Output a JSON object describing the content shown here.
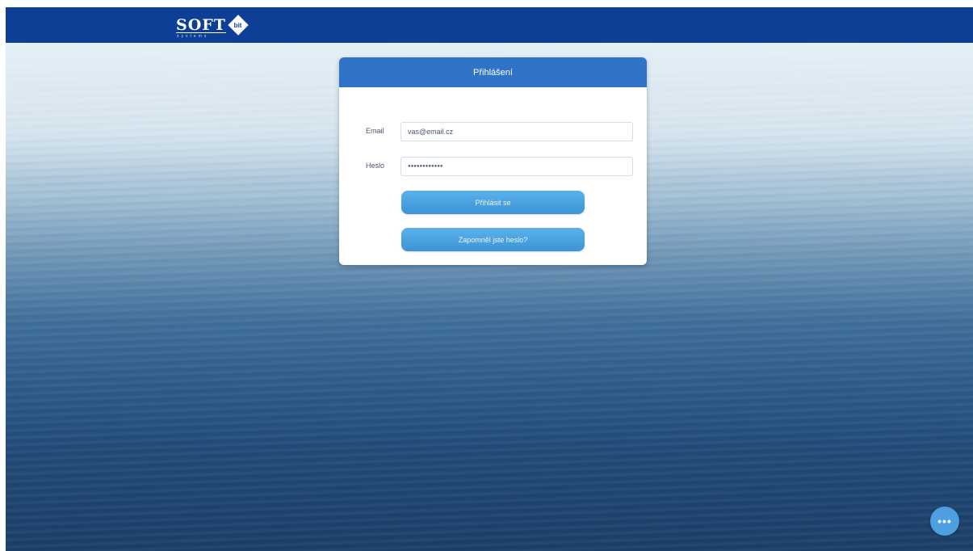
{
  "header": {
    "logo_text": "SOFT",
    "logo_badge": "bit",
    "logo_tagline": "systems"
  },
  "login": {
    "title": "Přihlášení",
    "email_label": "Email",
    "email_value": "vas@email.cz",
    "password_label": "Heslo",
    "password_value": "●●●●●●●●●●●●",
    "login_button": "Přihlásit se",
    "forgot_button": "Zapomněl jste heslo?"
  },
  "chat": {
    "label": "•••"
  }
}
